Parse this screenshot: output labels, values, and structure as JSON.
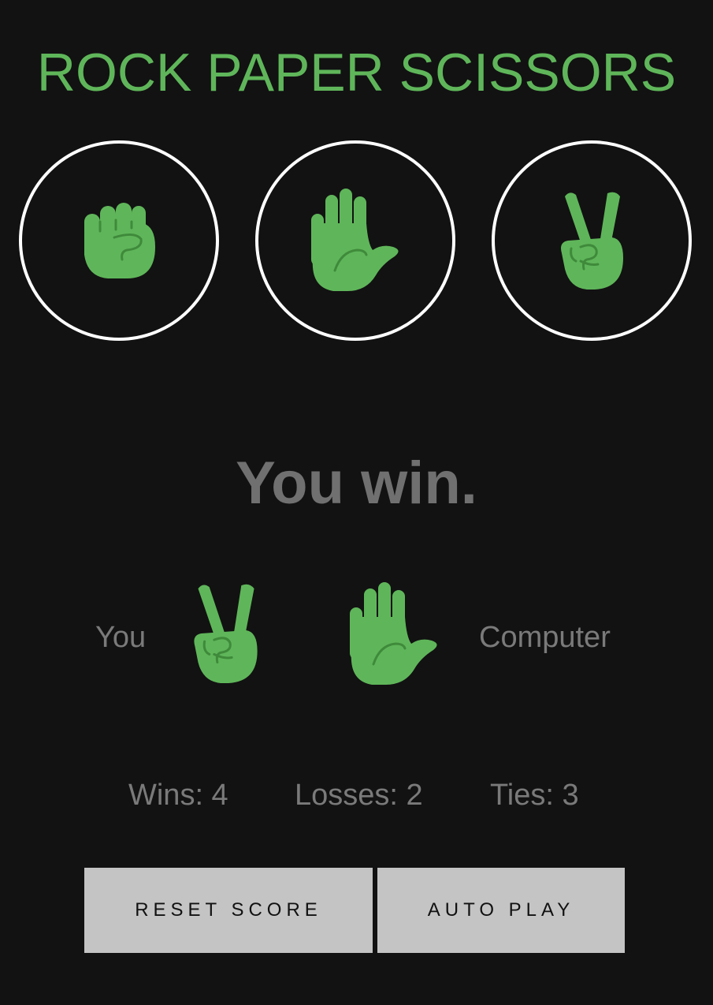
{
  "game": {
    "title": "ROCK PAPER SCISSORS",
    "accent_color": "#5fb65a",
    "choices": [
      {
        "name": "rock",
        "icon": "raised-fist-icon"
      },
      {
        "name": "paper",
        "icon": "raised-hand-icon"
      },
      {
        "name": "scissors",
        "icon": "victory-hand-icon"
      }
    ]
  },
  "result": {
    "text": "You win.",
    "player_label": "You",
    "player_move_icon": "victory-hand-icon",
    "computer_move_icon": "raised-hand-icon",
    "computer_label": "Computer"
  },
  "score": {
    "wins_text": "Wins: 4",
    "losses_text": "Losses: 2",
    "ties_text": "Ties: 3"
  },
  "buttons": {
    "reset_label": "RESET SCORE",
    "auto_play_label": "AUTO PLAY"
  }
}
